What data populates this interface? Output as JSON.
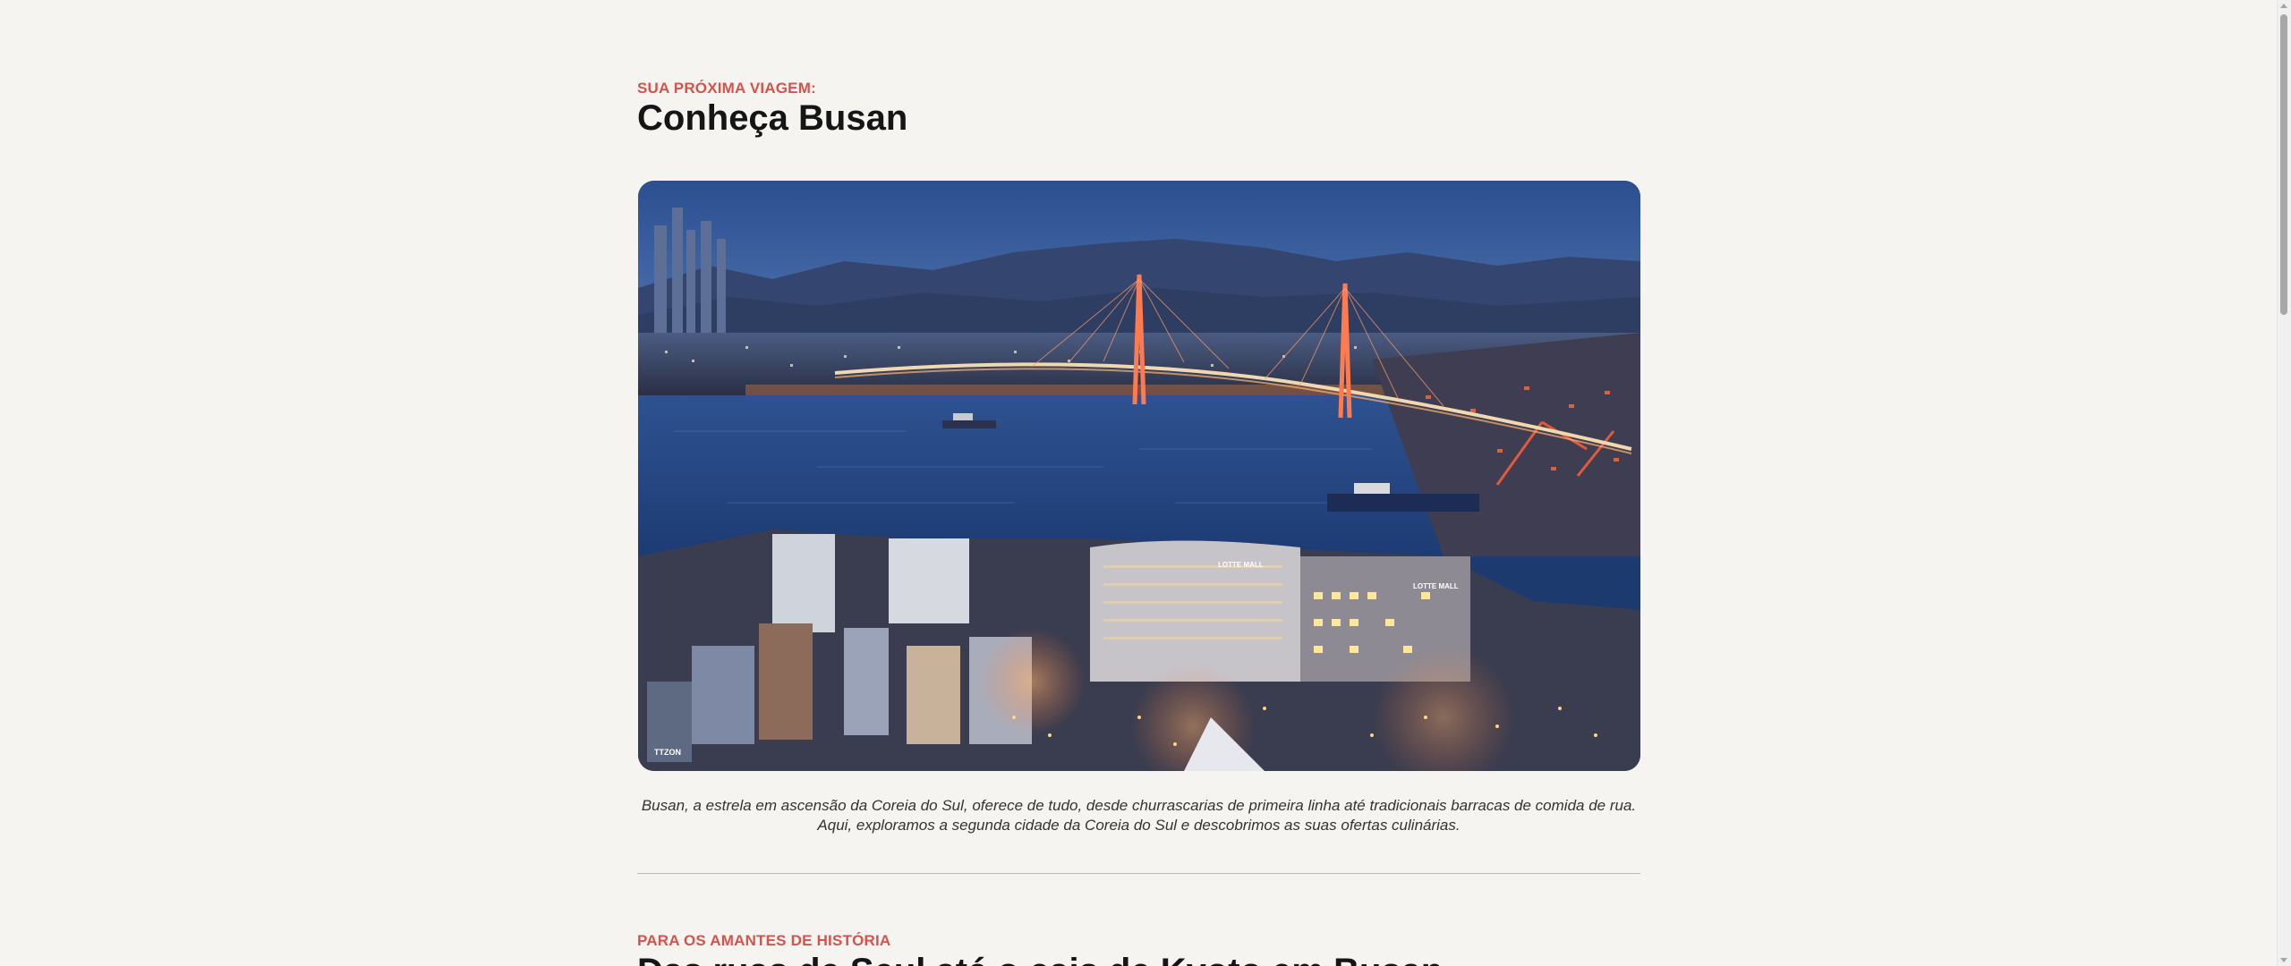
{
  "section1": {
    "eyebrow": "SUA PRÓXIMA VIAGEM:",
    "title": "Conheça Busan",
    "image_description": "Busan harbor at dusk with illuminated cable-stayed bridge and Lotte Mall",
    "caption": "Busan, a estrela em ascensão da Coreia do Sul, oferece de tudo, desde churrascarias de primeira linha até tradicionais barracas de comida de rua. Aqui, exploramos a segunda cidade da Coreia do Sul e descobrimos as suas ofertas culinárias."
  },
  "section2": {
    "eyebrow": "PARA OS AMANTES DE HISTÓRIA",
    "title_partial": "Das ruas de Seul até o cais de Kyoto em Busan"
  },
  "image_signs": {
    "mall1": "LOTTE MALL",
    "mall2": "LOTTE MALL",
    "corner": "TTZON"
  },
  "colors": {
    "accent": "#d6534a",
    "background": "#f5f4f1",
    "text": "#151515"
  }
}
